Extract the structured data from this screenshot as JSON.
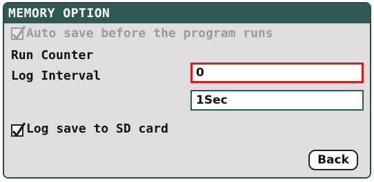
{
  "window": {
    "title": "MEMORY OPTION"
  },
  "options": {
    "auto_save": {
      "label": "Auto save before the program runs",
      "checked": true,
      "enabled": false
    },
    "run_counter": {
      "label": "Run Counter",
      "value": "0",
      "focused": true
    },
    "log_interval": {
      "label": "Log Interval",
      "value": "1Sec"
    },
    "log_to_sd": {
      "label": "Log save to SD card",
      "checked": true,
      "enabled": true
    }
  },
  "buttons": {
    "back_label": "Back"
  },
  "colors": {
    "title_bg": "#2f5953",
    "panel_bg": "#dedede",
    "focus_border": "#e0191b",
    "field_border": "#2f5953",
    "disabled_text": "#9a9a9a"
  }
}
